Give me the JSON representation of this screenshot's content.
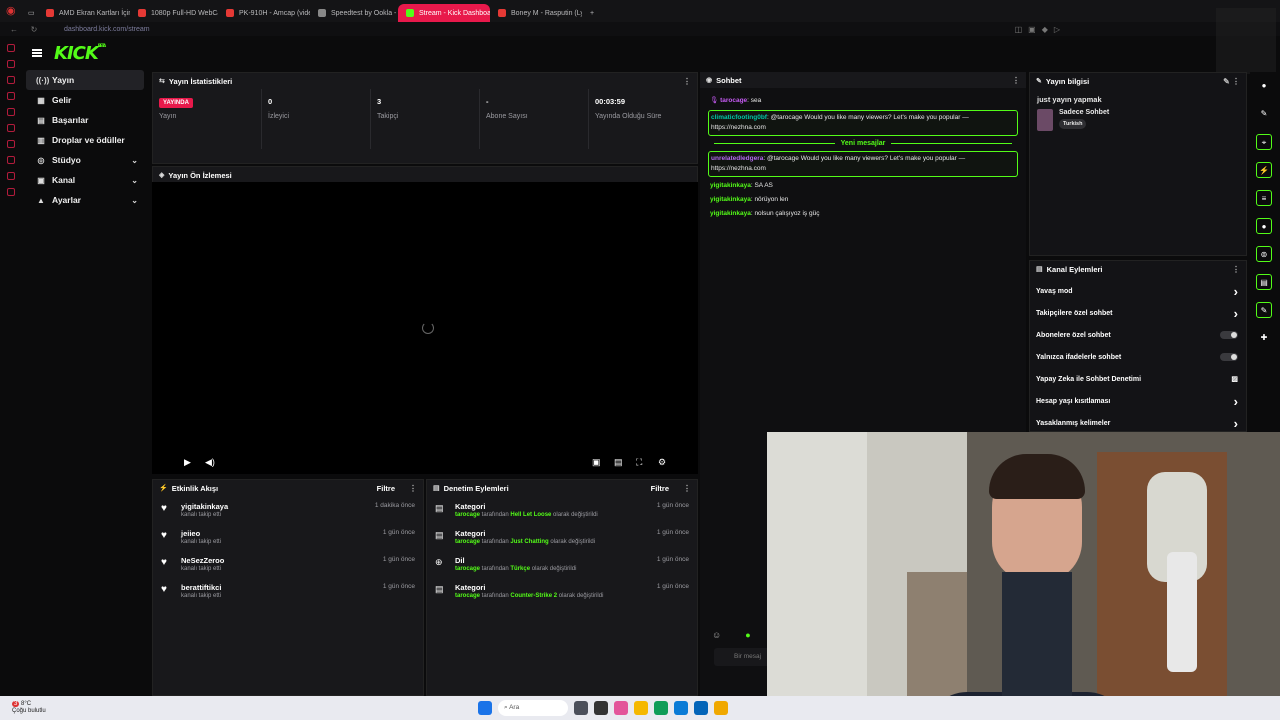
{
  "browser": {
    "tabs": [
      {
        "label": "AMD Ekran Kartları İçin O",
        "color": "#e53935"
      },
      {
        "label": "1080p Full-HD WebCam",
        "color": "#e53935"
      },
      {
        "label": "PK-910H - Amcap (video",
        "color": "#e53935"
      },
      {
        "label": "Speedtest by Ookla - The",
        "color": "#888888"
      },
      {
        "label": "Stream - Kick Dashboard",
        "color": "#53fc18",
        "active": true
      },
      {
        "label": "Boney M - Rasputin (Lyric",
        "color": "#e53935"
      }
    ],
    "new_tab": "+",
    "url": "dashboard.kick.com/stream"
  },
  "sidebar": {
    "logo": "KICK",
    "logo_badge": "BETA",
    "items": [
      {
        "label": "Yayın",
        "icon": "broadcast-icon",
        "active": true
      },
      {
        "label": "Gelir",
        "icon": "revenue-icon"
      },
      {
        "label": "Başarılar",
        "icon": "achievements-icon"
      },
      {
        "label": "Droplar ve ödüller",
        "icon": "drops-icon"
      },
      {
        "label": "Stüdyo",
        "icon": "studio-icon",
        "expandable": true
      },
      {
        "label": "Kanal",
        "icon": "channel-icon",
        "expandable": true
      },
      {
        "label": "Ayarlar",
        "icon": "settings-icon",
        "expandable": true
      }
    ]
  },
  "stats_panel": {
    "title": "Yayın İstatistikleri",
    "items": [
      {
        "value": "YAYINDA",
        "label": "Yayın",
        "badge": true
      },
      {
        "value": "0",
        "label": "İzleyici"
      },
      {
        "value": "3",
        "label": "Takipçi"
      },
      {
        "value": "-",
        "label": "Abone Sayısı"
      },
      {
        "value": "00:03:59",
        "label": "Yayında Olduğu Süre"
      }
    ]
  },
  "preview": {
    "title": "Yayın Ön İzlemesi"
  },
  "activity": {
    "title": "Etkinlik Akışı",
    "filter": "Filtre",
    "rows": [
      {
        "user": "yigitakinkaya",
        "action": "kanalı takip etti",
        "time": "1 dakika önce"
      },
      {
        "user": "jeiieo",
        "action": "kanalı takip etti",
        "time": "1 gün önce"
      },
      {
        "user": "NeSezZeroo",
        "action": "kanalı takip etti",
        "time": "1 gün önce"
      },
      {
        "user": "berattiftikci",
        "action": "kanalı takip etti",
        "time": "1 gün önce"
      }
    ]
  },
  "moderation": {
    "title": "Denetim Eylemleri",
    "filter": "Filtre",
    "rows": [
      {
        "title": "Kategori",
        "who": "tarocage",
        "mid": " tarafından ",
        "what": "Hell Let Loose",
        "end": " olarak değiştirildi",
        "time": "1 gün önce"
      },
      {
        "title": "Kategori",
        "who": "tarocage",
        "mid": " tarafından ",
        "what": "Just Chatting",
        "end": " olarak değiştirildi",
        "time": "1 gün önce"
      },
      {
        "title": "Dil",
        "who": "tarocage",
        "mid": " tarafından ",
        "what": "Türkçe",
        "end": " olarak değiştirildi",
        "time": "1 gün önce"
      },
      {
        "title": "Kategori",
        "who": "tarocage",
        "mid": " tarafından ",
        "what": "Counter-Strike 2",
        "end": " olarak değiştirildi",
        "time": "1 gün önce"
      }
    ]
  },
  "chat": {
    "title": "Sohbet",
    "messages": [
      {
        "user": "tarocage",
        "text": ": sea",
        "color": "#c75bf5"
      },
      {
        "user": "climaticfooting0bf",
        "text": ": @tarocage Would you like many viewers? Let's make you popular — https://nezhna.com",
        "color": "#00c8a6",
        "highlight": true
      },
      {
        "user": "unrelatedledgera",
        "text": ": @tarocage Would you like many viewers? Let's make you popular — https://nezhna.com",
        "color": "#b56cf0",
        "highlight": true
      },
      {
        "user": "yigitakinkaya",
        "text": ": SA AS",
        "color": "#53fc18"
      },
      {
        "user": "yigitakinkaya",
        "text": ": nörüyon len",
        "color": "#53fc18"
      },
      {
        "user": "yigitakinkaya",
        "text": ": nolsun çalışıyoz iş güç",
        "color": "#53fc18"
      }
    ],
    "new_messages": "Yeni mesajlar",
    "input_placeholder": "Bir mesaj"
  },
  "stream_info": {
    "title": "Yayın bilgisi",
    "stream_title": "just yayın yapmak",
    "category": "Sadece Sohbet",
    "tag": "Turkish"
  },
  "channel_actions": {
    "title": "Kanal Eylemleri",
    "rows": [
      {
        "label": "Yavaş mod",
        "control": "chevron"
      },
      {
        "label": "Takipçilere özel sohbet",
        "control": "chevron"
      },
      {
        "label": "Abonelere özel sohbet",
        "control": "toggle"
      },
      {
        "label": "Yalnızca ifadelerle sohbet",
        "control": "toggle"
      },
      {
        "label": "Yapay Zeka ile Sohbet Denetimi",
        "control": "chart"
      },
      {
        "label": "Hesap yaşı kısıtlaması",
        "control": "chevron"
      },
      {
        "label": "Yasaklanmış kelimeler",
        "control": "chevron"
      }
    ]
  },
  "taskbar": {
    "weather_temp": "8°C",
    "weather_desc": "Çoğu bulutlu",
    "search_label": "Ara",
    "notif_count": "3"
  }
}
